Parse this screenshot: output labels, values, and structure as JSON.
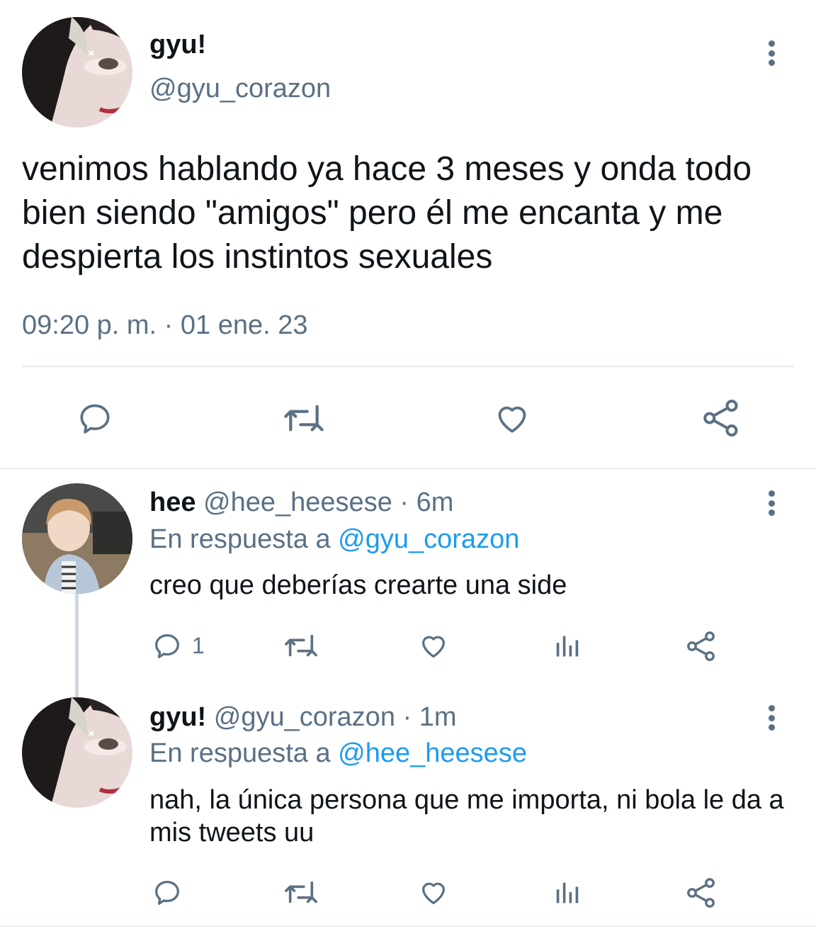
{
  "main_tweet": {
    "display_name": "gyu!",
    "handle": "@gyu_corazon",
    "text": "venimos hablando ya hace 3 meses y onda todo bien siendo \"amigos\" pero él me encanta y me despierta los instintos sexuales",
    "timestamp": "09:20 p. m. · 01 ene. 23",
    "actions": [
      "reply-icon",
      "retweet-icon",
      "like-icon",
      "share-icon"
    ]
  },
  "replies": [
    {
      "display_name": "hee",
      "handle": "@hee_heesese",
      "time": "· 6m",
      "reply_prefix": "En respuesta a",
      "reply_to": "@gyu_corazon",
      "text": "creo que deberías crearte una side",
      "reply_count": "1",
      "actions": [
        "reply-icon",
        "retweet-icon",
        "like-icon",
        "analytics-icon",
        "share-icon"
      ]
    },
    {
      "display_name": "gyu!",
      "handle": "@gyu_corazon",
      "time": "· 1m",
      "reply_prefix": "En respuesta a",
      "reply_to": "@hee_heesese",
      "text": "nah, la única persona que me importa, ni bola le da a mis tweets uu",
      "reply_count": "",
      "actions": [
        "reply-icon",
        "retweet-icon",
        "like-icon",
        "analytics-icon",
        "share-icon"
      ]
    }
  ],
  "colors": {
    "text": "#0f1419",
    "muted": "#5b7083",
    "link": "#1d9bf0",
    "divider": "#e6ecf0"
  }
}
